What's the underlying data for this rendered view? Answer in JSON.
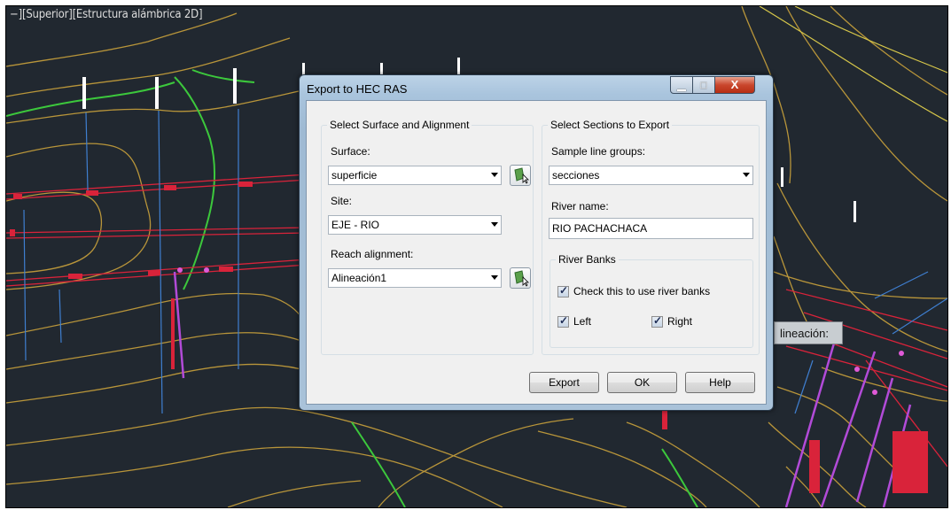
{
  "viewport": {
    "label": "−][Superior][Estructura alámbrica 2D]",
    "tooltip_text": "lineación:"
  },
  "colors": {
    "drawing_background": "#212830",
    "contour": "#b8953a",
    "centerline_green": "#3cc83c",
    "section_red": "#d9233a",
    "section_blue": "#3f7fd0",
    "station_purple": "#b24bd8"
  },
  "dialog": {
    "title": "Export to HEC RAS",
    "left_group": {
      "title": "Select Surface and Alignment",
      "surface_label": "Surface:",
      "surface_value": "superficie",
      "site_label": "Site:",
      "site_value": "EJE - RIO",
      "reach_label": "Reach alignment:",
      "reach_value": "Alineación1"
    },
    "right_group": {
      "title": "Select Sections to Export",
      "sample_label": "Sample line groups:",
      "sample_value": "secciones",
      "river_name_label": "River name:",
      "river_name_value": "RIO PACHACHACA",
      "banks": {
        "title": "River Banks",
        "use_banks_label": "Check this to use river banks",
        "use_banks_checked": true,
        "left_label": "Left",
        "left_checked": true,
        "right_label": "Right",
        "right_checked": true
      }
    },
    "buttons": {
      "export": "Export",
      "ok": "OK",
      "help": "Help"
    }
  }
}
